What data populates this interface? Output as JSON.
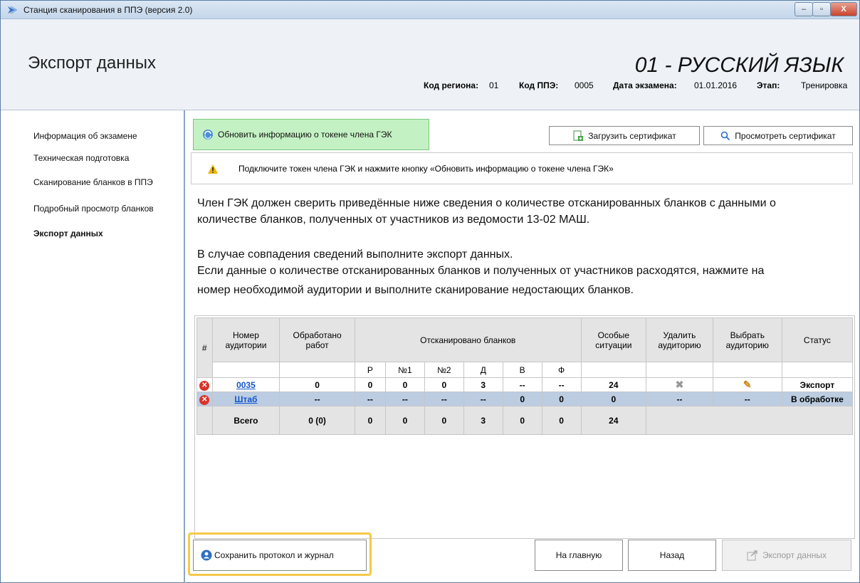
{
  "window": {
    "title": "Станция сканирования в ППЭ (версия 2.0)",
    "min": "–",
    "max": "▫",
    "close": "X"
  },
  "header": {
    "page_title": "Экспорт данных",
    "subject": "01 - РУССКИЙ ЯЗЫК",
    "region_label": "Код региона:",
    "region_value": "01",
    "ppe_label": "Код ППЭ:",
    "ppe_value": "0005",
    "date_label": "Дата экзамена:",
    "date_value": "01.01.2016",
    "stage_label": "Этап:",
    "stage_value": "Тренировка"
  },
  "sidebar": {
    "items": [
      {
        "label": "Информация об экзамене"
      },
      {
        "label": "Техническая подготовка"
      },
      {
        "label": "Сканирование бланков в ППЭ"
      },
      {
        "label": "Подробный просмотр бланков"
      },
      {
        "label": "Экспорт данных"
      }
    ]
  },
  "toolbar": {
    "refresh_label": "Обновить информацию о токене члена ГЭК",
    "load_cert_label": "Загрузить сертификат",
    "view_cert_label": "Просмотреть сертификат"
  },
  "warning": {
    "text": "Подключите токен члена ГЭК и нажмите кнопку «Обновить информацию о токене члена ГЭК»"
  },
  "instructions": {
    "line1": "Член ГЭК должен сверить приведённые ниже сведения о количестве отсканированных бланков с данными о",
    "line2": "количестве бланков, полученных от участников из ведомости 13-02 МАШ.",
    "line3": "В случае совпадения сведений выполните экспорт данных.",
    "line4": "Если данные о количестве отсканированных бланков и полученных от участников расходятся, нажмите на",
    "line5": "номер необходимой аудитории и выполните сканирование недостающих бланков."
  },
  "table": {
    "headers": {
      "num": "#",
      "room": "Номер аудитории",
      "processed": "Обработано работ",
      "scanned": "Отсканировано бланков",
      "special": "Особые ситуации",
      "delete": "Удалить аудиторию",
      "select": "Выбрать аудиторию",
      "status": "Статус"
    },
    "sub": [
      "Р",
      "№1",
      "№2",
      "Д",
      "В",
      "Ф"
    ],
    "rows": [
      {
        "room": "0035",
        "processed": "0",
        "r": "0",
        "n1": "0",
        "n2": "0",
        "d": "3",
        "v": "--",
        "f": "--",
        "special": "24",
        "delete": "✖",
        "select": "✎",
        "status": "Экспорт"
      },
      {
        "room": "Штаб",
        "processed": "--",
        "r": "--",
        "n1": "--",
        "n2": "--",
        "d": "--",
        "v": "0",
        "f": "0",
        "special": "0",
        "delete": "--",
        "select": "--",
        "status": "В обработке"
      }
    ],
    "total": {
      "label": "Всего",
      "processed": "0 (0)",
      "r": "0",
      "n1": "0",
      "n2": "0",
      "d": "3",
      "v": "0",
      "f": "0",
      "special": "24"
    }
  },
  "footer": {
    "save_label": "Сохранить протокол и журнал",
    "home_label": "На главную",
    "back_label": "Назад",
    "export_label": "Экспорт данных"
  }
}
